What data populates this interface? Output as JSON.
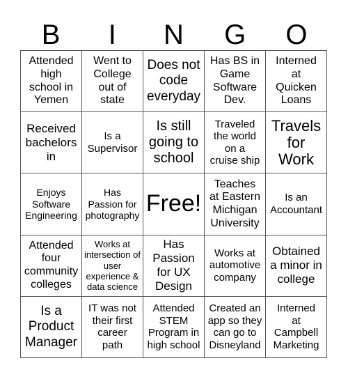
{
  "header": {
    "letters": [
      "B",
      "I",
      "N",
      "G",
      "O"
    ]
  },
  "card": {
    "rows": [
      [
        "Attended\nhigh\nschool in\nYemen",
        "Went to\nCollege\nout of\nstate",
        "Does not\ncode\neveryday",
        "Has BS in\nGame\nSoftware\nDev.",
        "Interned\nat\nQuicken\nLoans"
      ],
      [
        "Received\nbachelors\nin",
        "Is a\nSupervisor",
        "Is still\ngoing to\nschool",
        "Traveled\nthe world\non a\ncruise ship",
        "Travels\nfor\nWork"
      ],
      [
        "Enjoys\nSoftware\nEngineering",
        "Has\nPassion for\nphotography",
        "Free!",
        "Teaches\nat Eastern\nMichigan\nUniversity",
        "Is an\nAccountant"
      ],
      [
        "Attended\nfour\ncommunity\ncolleges",
        "Works at\nintersection of\nuser\nexperience &\ndata science",
        "Has\nPassion\nfor UX\nDesign",
        "Works at\nautomotive\ncompany",
        "Obtained\na minor in\ncollege"
      ],
      [
        "Is a\nProduct\nManager",
        "IT was not\ntheir first\ncareer\npath",
        "Attended\nSTEM\nProgram in\nhigh school",
        "Created an\napp so they\ncan go to\nDisneyland",
        "Interned\nat\nCampbell\nMarketing"
      ]
    ]
  }
}
